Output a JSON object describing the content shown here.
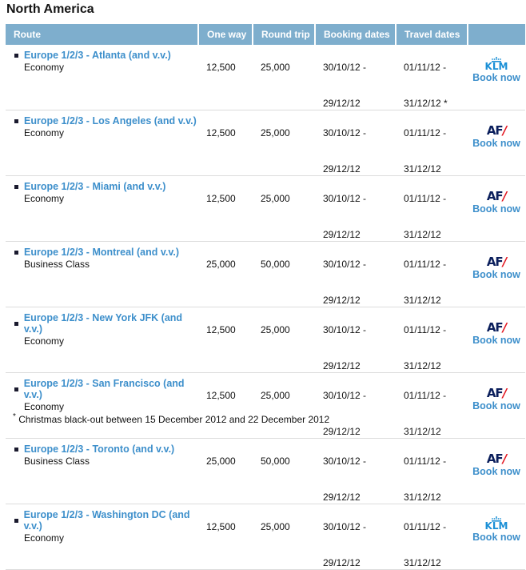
{
  "region_title": "North America",
  "table": {
    "headers": [
      "Route",
      "One way",
      "Round trip",
      "Booking dates",
      "Travel dates",
      ""
    ],
    "rows": [
      {
        "route": "Europe 1/2/3 - Atlanta (and v.v.)",
        "cabin": "Economy",
        "one_way": "12,500",
        "round_trip": "25,000",
        "booking_from": "30/10/12 -",
        "booking_to": "29/12/12",
        "travel_from": "01/11/12 -",
        "travel_to": "31/12/12 *",
        "airline": "KLM",
        "book_label": "Book now"
      },
      {
        "route": "Europe 1/2/3 - Los Angeles (and v.v.)",
        "cabin": "Economy",
        "one_way": "12,500",
        "round_trip": "25,000",
        "booking_from": "30/10/12 -",
        "booking_to": "29/12/12",
        "travel_from": "01/11/12 -",
        "travel_to": "31/12/12",
        "airline": "AF",
        "book_label": "Book now"
      },
      {
        "route": "Europe 1/2/3 - Miami (and v.v.)",
        "cabin": "Economy",
        "one_way": "12,500",
        "round_trip": "25,000",
        "booking_from": "30/10/12 -",
        "booking_to": "29/12/12",
        "travel_from": "01/11/12 -",
        "travel_to": "31/12/12",
        "airline": "AF",
        "book_label": "Book now"
      },
      {
        "route": "Europe 1/2/3 - Montreal (and v.v.)",
        "cabin": "Business Class",
        "one_way": "25,000",
        "round_trip": "50,000",
        "booking_from": "30/10/12 -",
        "booking_to": "29/12/12",
        "travel_from": "01/11/12 -",
        "travel_to": "31/12/12",
        "airline": "AF",
        "book_label": "Book now"
      },
      {
        "route": "Europe 1/2/3 - New York JFK (and v.v.)",
        "cabin": "Economy",
        "one_way": "12,500",
        "round_trip": "25,000",
        "booking_from": "30/10/12 -",
        "booking_to": "29/12/12",
        "travel_from": "01/11/12 -",
        "travel_to": "31/12/12",
        "airline": "AF",
        "book_label": "Book now"
      },
      {
        "route": "Europe 1/2/3 - San Francisco (and v.v.)",
        "cabin": "Economy",
        "one_way": "12,500",
        "round_trip": "25,000",
        "booking_from": "30/10/12 -",
        "booking_to": "29/12/12",
        "travel_from": "01/11/12 -",
        "travel_to": "31/12/12",
        "airline": "AF",
        "book_label": "Book now"
      },
      {
        "route": "Europe 1/2/3 - Toronto (and v.v.)",
        "cabin": "Business Class",
        "one_way": "25,000",
        "round_trip": "50,000",
        "booking_from": "30/10/12 -",
        "booking_to": "29/12/12",
        "travel_from": "01/11/12 -",
        "travel_to": "31/12/12",
        "airline": "AF",
        "book_label": "Book now"
      },
      {
        "route": "Europe 1/2/3 - Washington DC (and v.v.)",
        "cabin": "Economy",
        "one_way": "12,500",
        "round_trip": "25,000",
        "booking_from": "30/10/12 -",
        "booking_to": "29/12/12",
        "travel_from": "01/11/12 -",
        "travel_to": "31/12/12",
        "airline": "KLM",
        "book_label": "Book now"
      }
    ]
  },
  "logos": {
    "AF": {
      "text": "AF",
      "slash": "/",
      "icon": "air-france-logo-icon"
    },
    "KLM": {
      "text": "KLM",
      "icon": "klm-crown-logo-icon"
    }
  },
  "footnote": {
    "marker": "*",
    "text": "Christmas black-out between 15 December 2012 and 22 December 2012"
  },
  "colors": {
    "header_bg": "#7eaecd",
    "link": "#3d8fcb",
    "af_blue": "#0b1f5c",
    "af_red": "#e3151f",
    "klm_blue": "#1a8fd6"
  }
}
